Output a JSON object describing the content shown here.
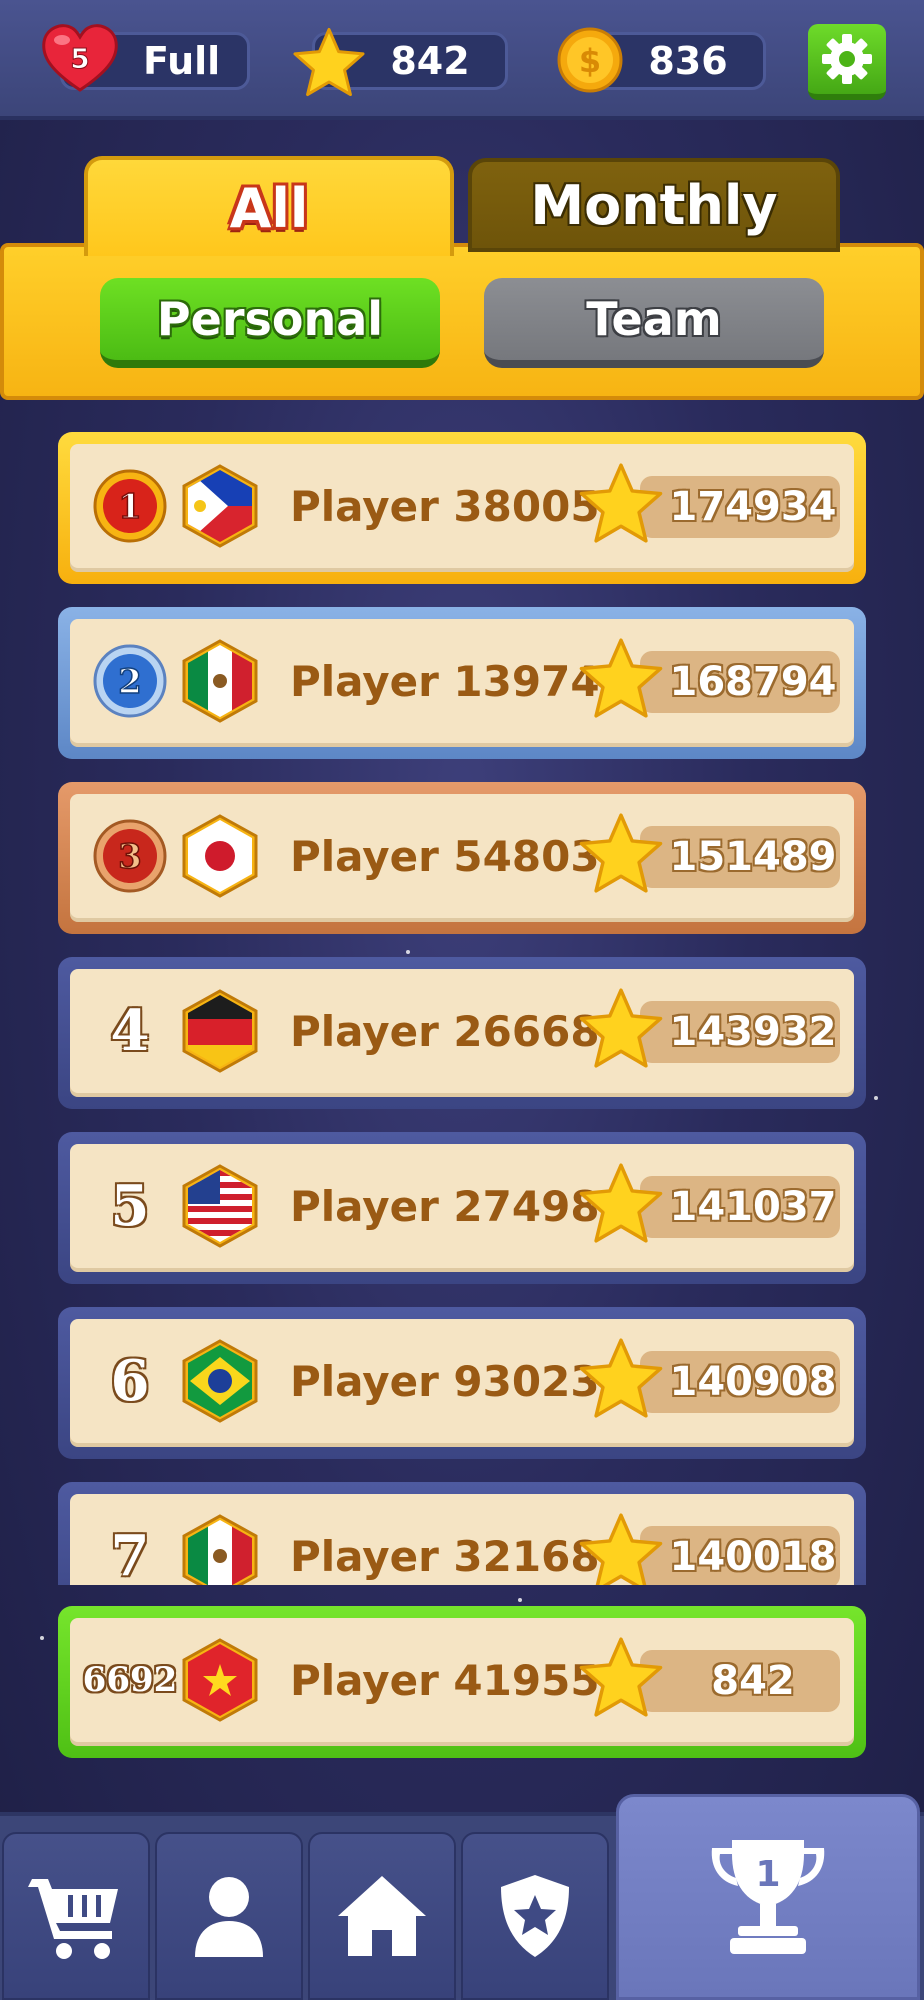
{
  "header": {
    "lives_count": "5",
    "lives_status": "Full",
    "stars": "842",
    "coins": "836"
  },
  "tabs": {
    "all": "All",
    "monthly": "Monthly",
    "personal": "Personal",
    "team": "Team"
  },
  "leaderboard": [
    {
      "rank": "1",
      "flag": "Philippines",
      "name": "Player 380057",
      "score": "174934"
    },
    {
      "rank": "2",
      "flag": "Mexico",
      "name": "Player 139742",
      "score": "168794"
    },
    {
      "rank": "3",
      "flag": "Japan",
      "name": "Player 548031",
      "score": "151489"
    },
    {
      "rank": "4",
      "flag": "Germany",
      "name": "Player 266682",
      "score": "143932"
    },
    {
      "rank": "5",
      "flag": "USA",
      "name": "Player 274986",
      "score": "141037"
    },
    {
      "rank": "6",
      "flag": "Brazil",
      "name": "Player 930236",
      "score": "140908"
    },
    {
      "rank": "7",
      "flag": "Mexico",
      "name": "Player 321685",
      "score": "140018"
    }
  ],
  "my_row": {
    "rank": "6692",
    "flag": "Vietnam",
    "name": "Player 419551",
    "score": "842"
  },
  "nav": {
    "trophy_badge": "1",
    "items": [
      "cart-icon",
      "profile-icon",
      "home-icon",
      "shield-star-icon",
      "trophy-icon"
    ]
  },
  "colors": {
    "gold": "#f7b413",
    "green": "#4cbc14",
    "name_brown": "#9a5a14",
    "row_bg": "#f5e4c4"
  }
}
